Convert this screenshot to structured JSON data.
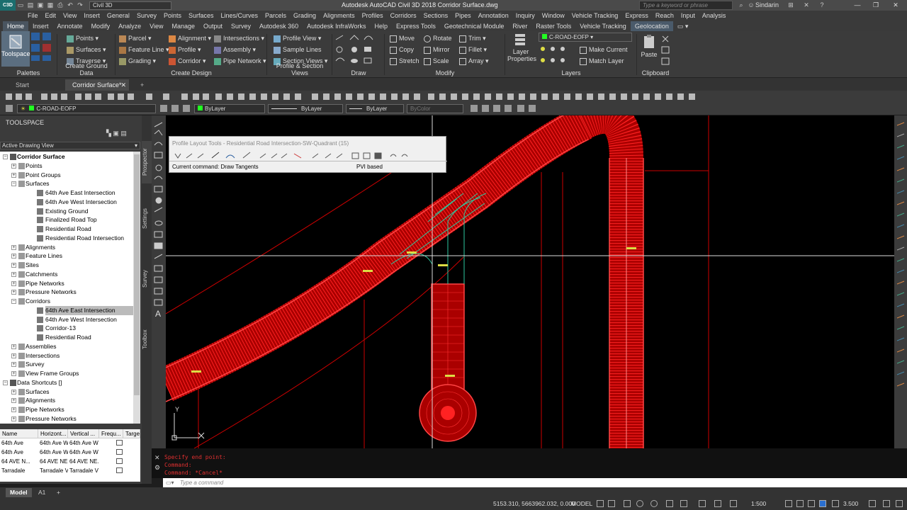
{
  "titlebar": {
    "app_logo": "C3D",
    "workspace": "Civil 3D",
    "title": "Autodesk AutoCAD Civil 3D 2018   Corridor Surface.dwg",
    "search_placeholder": "Type a keyword or phrase",
    "user": "Sindarin"
  },
  "menu": [
    "File",
    "Edit",
    "View",
    "Insert",
    "General",
    "Survey",
    "Points",
    "Surfaces",
    "Lines/Curves",
    "Parcels",
    "Grading",
    "Alignments",
    "Profiles",
    "Corridors",
    "Sections",
    "Pipes",
    "Annotation",
    "Inquiry",
    "Window",
    "Vehicle Tracking",
    "Express",
    "Reach",
    "Input",
    "Analysis"
  ],
  "ribbon_tabs": [
    "Home",
    "Insert",
    "Annotate",
    "Modify",
    "Analyze",
    "View",
    "Manage",
    "Output",
    "Survey",
    "Autodesk 360",
    "Autodesk InfraWorks",
    "Help",
    "Express Tools",
    "Geotechnical Module",
    "River",
    "Raster Tools",
    "Vehicle Tracking",
    "Geolocation"
  ],
  "ribbon": {
    "toolspace": "Toolspace",
    "palettes": "Palettes",
    "ground": {
      "title": "Create Ground Data",
      "points": "Points",
      "surfaces": "Surfaces",
      "traverse": "Traverse"
    },
    "design": {
      "title": "Create Design",
      "parcel": "Parcel",
      "feature_line": "Feature Line",
      "grading": "Grading",
      "alignment": "Alignment",
      "profile": "Profile",
      "corridor": "Corridor",
      "intersections": "Intersections",
      "assembly": "Assembly",
      "pipe_network": "Pipe Network"
    },
    "profile_views": {
      "title": "Profile & Section Views",
      "profile_view": "Profile View",
      "sample_lines": "Sample Lines",
      "section_views": "Section Views"
    },
    "draw": {
      "title": "Draw"
    },
    "modify": {
      "title": "Modify",
      "move": "Move",
      "rotate": "Rotate",
      "trim": "Trim",
      "copy": "Copy",
      "mirror": "Mirror",
      "fillet": "Fillet",
      "stretch": "Stretch",
      "scale": "Scale",
      "array": "Array"
    },
    "layers": {
      "title": "Layers",
      "layer_properties_1": "Layer",
      "layer_properties_2": "Properties",
      "layer": "C-ROAD-EOFP",
      "make_current": "Make Current",
      "match_layer": "Match Layer"
    },
    "clipboard": {
      "title": "Clipboard",
      "paste": "Paste"
    }
  },
  "doc_tabs": {
    "start": "Start",
    "active": "Corridor Surface*"
  },
  "toolbar": {
    "layer": "C-ROAD-EOFP",
    "color": "ByLayer",
    "linetype": "ByLayer",
    "lineweight": "ByLayer",
    "plotstyle": "ByColor"
  },
  "toolspace": {
    "header": "TOOLSPACE",
    "view": "Active Drawing View",
    "tabs": [
      "Prospector",
      "Settings",
      "Survey",
      "Toolbox"
    ],
    "tree": [
      {
        "label": "Corridor Surface",
        "level": 0,
        "bold": true
      },
      {
        "label": "Points",
        "level": 1
      },
      {
        "label": "Point Groups",
        "level": 1
      },
      {
        "label": "Surfaces",
        "level": 1
      },
      {
        "label": "64th Ave East Intersection",
        "level": 2
      },
      {
        "label": "64th Ave West Intersection",
        "level": 2
      },
      {
        "label": "Existing Ground",
        "level": 2
      },
      {
        "label": "Finalized Road Top",
        "level": 2
      },
      {
        "label": "Residential Road",
        "level": 2
      },
      {
        "label": "Residential Road Intersection",
        "level": 2
      },
      {
        "label": "Alignments",
        "level": 1
      },
      {
        "label": "Feature Lines",
        "level": 1
      },
      {
        "label": "Sites",
        "level": 1
      },
      {
        "label": "Catchments",
        "level": 1
      },
      {
        "label": "Pipe Networks",
        "level": 1
      },
      {
        "label": "Pressure Networks",
        "level": 1
      },
      {
        "label": "Corridors",
        "level": 1
      },
      {
        "label": "64th Ave East Intersection",
        "level": 2,
        "selected": true
      },
      {
        "label": "64th Ave West Intersection",
        "level": 2
      },
      {
        "label": "Corridor-13",
        "level": 2
      },
      {
        "label": "Residential Road",
        "level": 2
      },
      {
        "label": "Assemblies",
        "level": 1
      },
      {
        "label": "Intersections",
        "level": 1
      },
      {
        "label": "Survey",
        "level": 1
      },
      {
        "label": "View Frame Groups",
        "level": 1
      },
      {
        "label": "Data Shortcuts []",
        "level": 0
      },
      {
        "label": "Surfaces",
        "level": 1
      },
      {
        "label": "Alignments",
        "level": 1
      },
      {
        "label": "Pipe Networks",
        "level": 1
      },
      {
        "label": "Pressure Networks",
        "level": 1
      }
    ],
    "list_headers": [
      "Name",
      "Horizont...",
      "Vertical ...",
      "Frequ...",
      "Targe"
    ],
    "list_rows": [
      [
        "64th Ave",
        "64th Ave W",
        "64th Ave W"
      ],
      [
        "64th Ave",
        "64th Ave W",
        "64th Ave W"
      ],
      [
        "64 AVE N...",
        "64 AVE NE...",
        "64 AVE NE..."
      ],
      [
        "Tarradale",
        "Tarradale V",
        "Tarradale V"
      ]
    ]
  },
  "profile_tools": {
    "title": "Profile Layout Tools - Residential Road Intersection-SW-Quadrant (15)",
    "command": "Current command: Draw Tangents",
    "mode": "PVI based"
  },
  "command": {
    "history": [
      "Specify end point:",
      "Command:",
      "Command: *Cancel*"
    ],
    "placeholder": "Type a command"
  },
  "layout_tabs": [
    "Model",
    "A1"
  ],
  "status": {
    "coords": "5153.310, 5663962.032, 0.000",
    "model": "MODEL",
    "scale": "1:500",
    "annoscale": "3.500"
  },
  "drawing": {
    "x_axis": "X",
    "y_axis": "Y"
  }
}
